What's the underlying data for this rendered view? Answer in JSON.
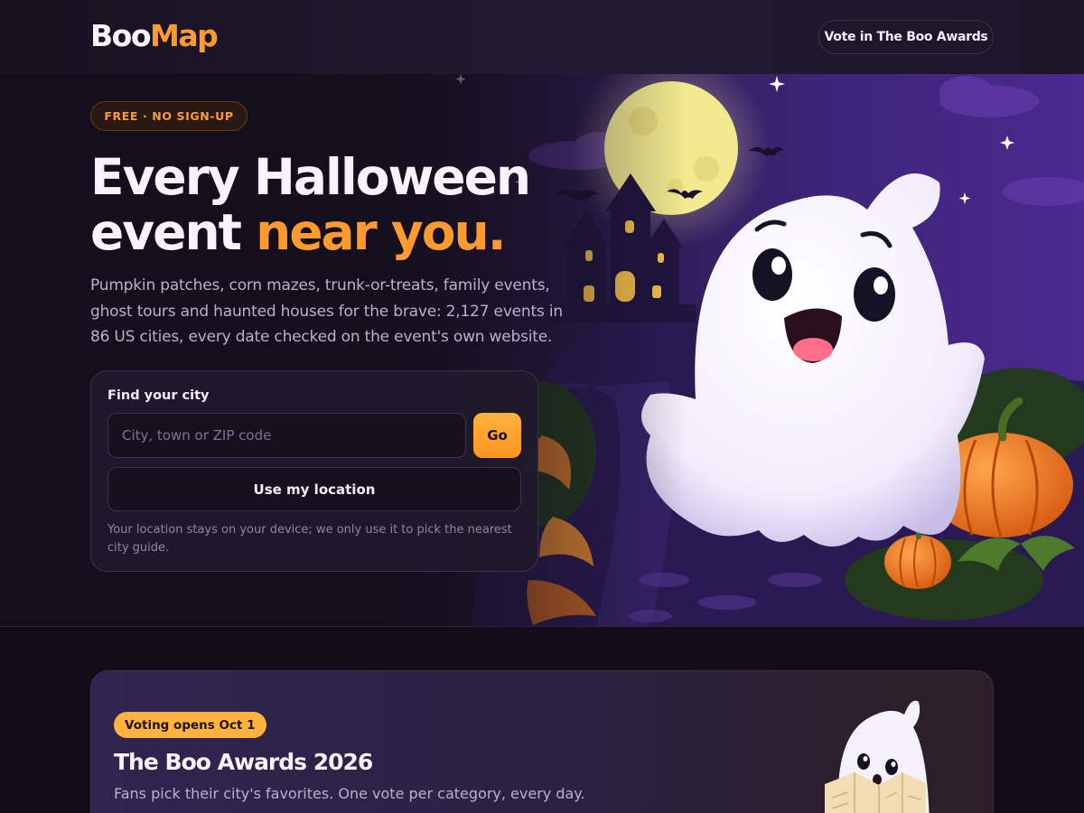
{
  "header": {
    "logo_primary": "Boo",
    "logo_accent": "Map",
    "vote_button": "Vote in The Boo Awards"
  },
  "hero": {
    "badge": "FREE · NO SIGN-UP",
    "title_line1": "Every Halloween",
    "title_line2_plain": "event ",
    "title_line2_accent": "near you.",
    "description": "Pumpkin patches, corn mazes, trunk-or-treats, family events, ghost tours and haunted houses for the brave: 2,127 events in 86 US cities, every date checked on the event's own website."
  },
  "finder": {
    "label": "Find your city",
    "input_value": "",
    "input_placeholder": "City, town or ZIP code",
    "go_button": "Go",
    "location_button": "Use my location",
    "note": "Your location stays on your device; we only use it to pick the nearest city guide."
  },
  "awards": {
    "pill": "Voting opens Oct 1",
    "title": "The Boo Awards 2026",
    "subtitle": "Fans pick their city's favorites. One vote per category, every day."
  },
  "colors": {
    "background": "#110e18",
    "accent_orange": "#ff9a2e",
    "pill_yellow": "#ffb23d",
    "hero_purple": "#4a2a8e"
  },
  "icons": [
    "ghost-illustration",
    "moon-illustration",
    "haunted-house-illustration",
    "pumpkin-illustration",
    "bat-icon",
    "star-icon",
    "ghost-with-map-illustration"
  ]
}
